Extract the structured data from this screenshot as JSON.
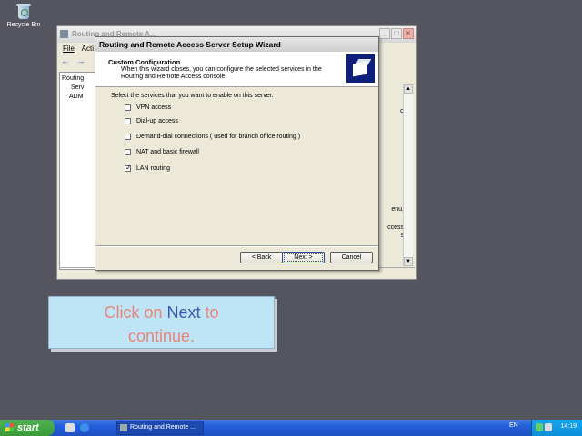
{
  "desktop": {
    "recycle_bin_label": "Recycle Bin"
  },
  "mmc": {
    "title": "Routing and Remote A...",
    "menu": [
      "File",
      "Acti"
    ],
    "tree": [
      "Routing",
      "Serv",
      "ADM"
    ],
    "right_fragments": [
      "o",
      "enu,",
      "ccess",
      "s"
    ]
  },
  "wizard": {
    "title": "Routing and Remote Access Server Setup Wizard",
    "heading": "Custom Configuration",
    "subtitle": "When this wizard closes, you can configure the selected services in the Routing and Remote Access console.",
    "instruction": "Select the services that you want to enable on this server.",
    "options": [
      {
        "label": "VPN access",
        "checked": false
      },
      {
        "label": "Dial-up access",
        "checked": false
      },
      {
        "label": "Demand-dial connections ( used for branch office routing )",
        "checked": false
      },
      {
        "label": "NAT and basic firewall",
        "checked": false
      },
      {
        "label": "LAN routing",
        "checked": true
      }
    ],
    "back_label": "< Back",
    "next_label": "Next >",
    "cancel_label": "Cancel"
  },
  "callout": {
    "line1_pre": "Click on ",
    "line1_highlight": "Next",
    "line1_post": " to",
    "line2": "continue."
  },
  "taskbar": {
    "start_label": "start",
    "task_label": "Routing and Remote ...",
    "language": "EN",
    "clock": "14:19"
  }
}
